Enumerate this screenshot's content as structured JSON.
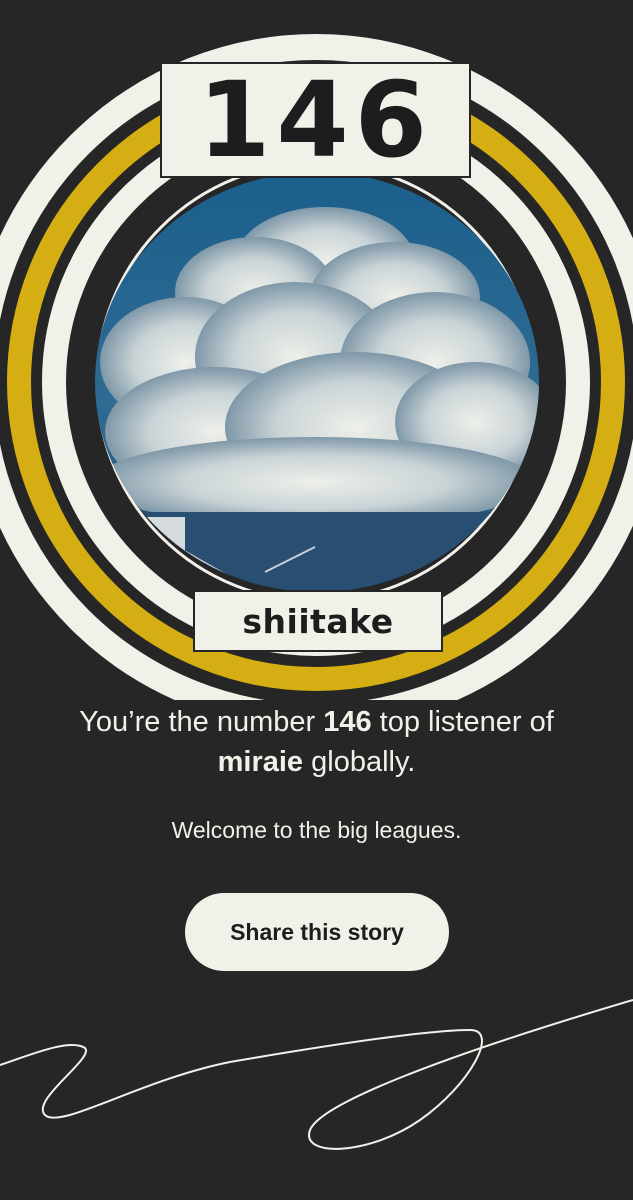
{
  "rank": "146",
  "username": "shiitake",
  "message": {
    "prefix": "You’re the number ",
    "rank": "146",
    "middle": " top listener of",
    "artist": "miraie",
    "suffix": " globally."
  },
  "subtext": "Welcome to the big leagues.",
  "share_button": "Share this story",
  "colors": {
    "background": "#262626",
    "ring_light": "#f1f1ea",
    "ring_accent": "#d4ae12",
    "text": "#f1f1ea"
  },
  "icons": [
    "squiggle-decoration"
  ]
}
